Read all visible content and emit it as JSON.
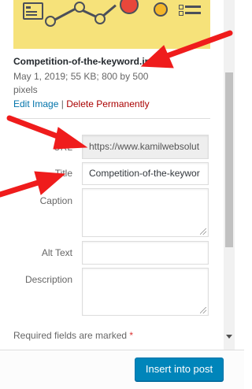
{
  "attachment": {
    "filename": "Competition-of-the-keyword.jpg",
    "meta_line1": "May 1, 2019;  55 KB;  800 by 500",
    "meta_line2": "pixels",
    "edit_link": "Edit Image",
    "separator": "|",
    "delete_link": "Delete Permanently"
  },
  "fields": {
    "url": {
      "label": "URL",
      "value": "https://www.kamilwebsolut"
    },
    "title": {
      "label": "Title",
      "value": "Competition-of-the-keywor"
    },
    "caption": {
      "label": "Caption",
      "value": ""
    },
    "alt_text": {
      "label": "Alt Text",
      "value": ""
    },
    "description": {
      "label": "Description",
      "value": ""
    }
  },
  "notice": {
    "text": "Required fields are marked ",
    "star": "*"
  },
  "footer": {
    "insert_button": "Insert into post"
  },
  "colors": {
    "arrow": "#ef1c1c",
    "button": "#0085ba",
    "delete": "#aa0000",
    "link": "#0073aa",
    "thumb_bg": "#f6e27a"
  },
  "icons": [
    "document-icon",
    "chart-line-icon",
    "magnifier-icon",
    "coin-icon",
    "list-icon",
    "scroll-down-icon",
    "resize-grip-icon"
  ]
}
